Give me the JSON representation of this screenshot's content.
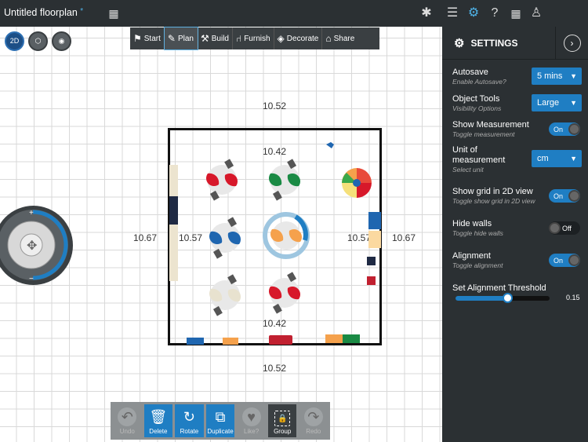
{
  "header": {
    "title": "Untitled floorplan",
    "modified_marker": "*",
    "icons": [
      "snowflake-icon",
      "menu-icon",
      "settings-icon",
      "help-icon",
      "store-icon",
      "user-icon"
    ]
  },
  "view_buttons": [
    {
      "label": "2D",
      "active": true
    },
    {
      "label": "3D",
      "active": false
    },
    {
      "label": "eye",
      "active": false
    }
  ],
  "modes": [
    {
      "label": "Start",
      "icon": "flag-icon",
      "active": false
    },
    {
      "label": "Plan",
      "icon": "pencil-icon",
      "active": true
    },
    {
      "label": "Build",
      "icon": "build-icon",
      "active": false
    },
    {
      "label": "Furnish",
      "icon": "chair-icon",
      "active": false
    },
    {
      "label": "Decorate",
      "icon": "paint-bucket-icon",
      "active": false
    },
    {
      "label": "Share",
      "icon": "share-icon",
      "active": false
    }
  ],
  "dimensions": {
    "outer_top": "10.52",
    "inner_top": "10.42",
    "outer_left": "10.67",
    "inner_left": "10.57",
    "inner_right": "10.57",
    "outer_right": "10.67",
    "inner_bottom": "10.42",
    "outer_bottom": "10.52"
  },
  "settings": {
    "title": "SETTINGS",
    "autosave": {
      "label": "Autosave",
      "sub": "Enable Autosave?",
      "value": "5 mins"
    },
    "object_tools": {
      "label": "Object Tools",
      "sub": "Visibility Options",
      "value": "Large"
    },
    "show_measurement": {
      "label": "Show Measurement",
      "sub": "Toggle measurement",
      "value": "On"
    },
    "unit": {
      "label": "Unit of measurement",
      "sub": "Select unit",
      "value": "cm"
    },
    "show_grid": {
      "label": "Show grid in 2D view",
      "sub": "Toggle show grid in 2D view",
      "value": "On"
    },
    "hide_walls": {
      "label": "Hide walls",
      "sub": "Toggle hide walls",
      "value": "Off"
    },
    "alignment": {
      "label": "Alignment",
      "sub": "Toggle alignment",
      "value": "On"
    },
    "threshold": {
      "label": "Set Alignment Threshold",
      "value": "0.15",
      "fraction": 0.55
    }
  },
  "bottom_toolbar": [
    {
      "label": "Undo",
      "state": "disabled"
    },
    {
      "label": "Delete",
      "state": "active"
    },
    {
      "label": "Rotate",
      "state": "active"
    },
    {
      "label": "Duplicate",
      "state": "active"
    },
    {
      "label": "Like?",
      "state": "disabled"
    },
    {
      "label": "Group",
      "state": "dark"
    },
    {
      "label": "Redo",
      "state": "disabled"
    }
  ],
  "tables": [
    {
      "color": "#d7182a"
    },
    {
      "color": "#1a8a44"
    },
    {
      "color": "#1f66b0"
    },
    {
      "color": "#f5a14c"
    },
    {
      "color": "#e8e2cf"
    },
    {
      "color": "#d7182a"
    }
  ]
}
